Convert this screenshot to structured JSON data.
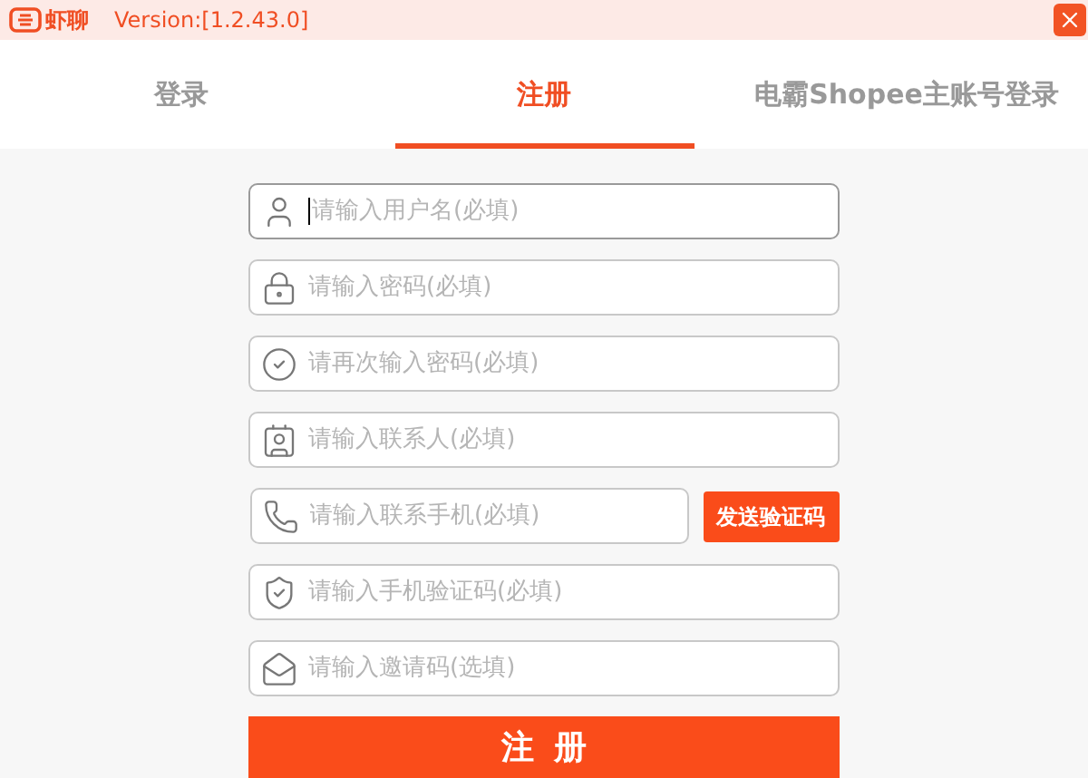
{
  "window": {
    "logo_text": "虾聊",
    "version": "Version:[1.2.43.0]"
  },
  "tabs": [
    {
      "label": "登录",
      "selected": false
    },
    {
      "label": "注册",
      "selected": true
    },
    {
      "label": "电霸Shopee主账号登录",
      "selected": false
    }
  ],
  "fields": [
    {
      "kind": "text",
      "placeholder": "请输入用户名(必填)",
      "focused": true
    },
    {
      "kind": "text",
      "placeholder": "请输入密码(必填)",
      "focused": false
    },
    {
      "kind": "text",
      "placeholder": "请再次输入密码(必填)",
      "focused": false
    },
    {
      "kind": "text",
      "placeholder": "请输入联系人(必填)",
      "focused": false
    },
    {
      "kind": "sms",
      "placeholder": "请输入联系手机(必填)",
      "focused": false,
      "button": "发送验证码"
    },
    {
      "kind": "text",
      "placeholder": "请输入手机验证码(必填)",
      "focused": false
    },
    {
      "kind": "text",
      "placeholder": "请输入邀请码(选填)",
      "focused": false
    }
  ],
  "submit": "注册"
}
